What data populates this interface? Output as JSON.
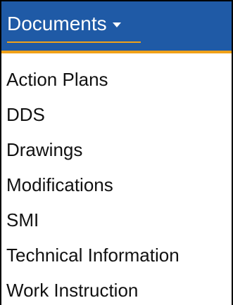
{
  "menu": {
    "title": "Documents",
    "items": [
      {
        "label": "Action Plans"
      },
      {
        "label": "DDS"
      },
      {
        "label": "Drawings"
      },
      {
        "label": "Modifications"
      },
      {
        "label": "SMI"
      },
      {
        "label": "Technical Information"
      },
      {
        "label": "Work Instruction"
      }
    ]
  },
  "colors": {
    "header_background": "#1f5aa6",
    "header_accent": "#f0a11a",
    "header_text": "#ffffff",
    "item_text": "#111111",
    "frame_border": "#000000"
  },
  "icons": {
    "dropdown": "caret-down-icon"
  }
}
